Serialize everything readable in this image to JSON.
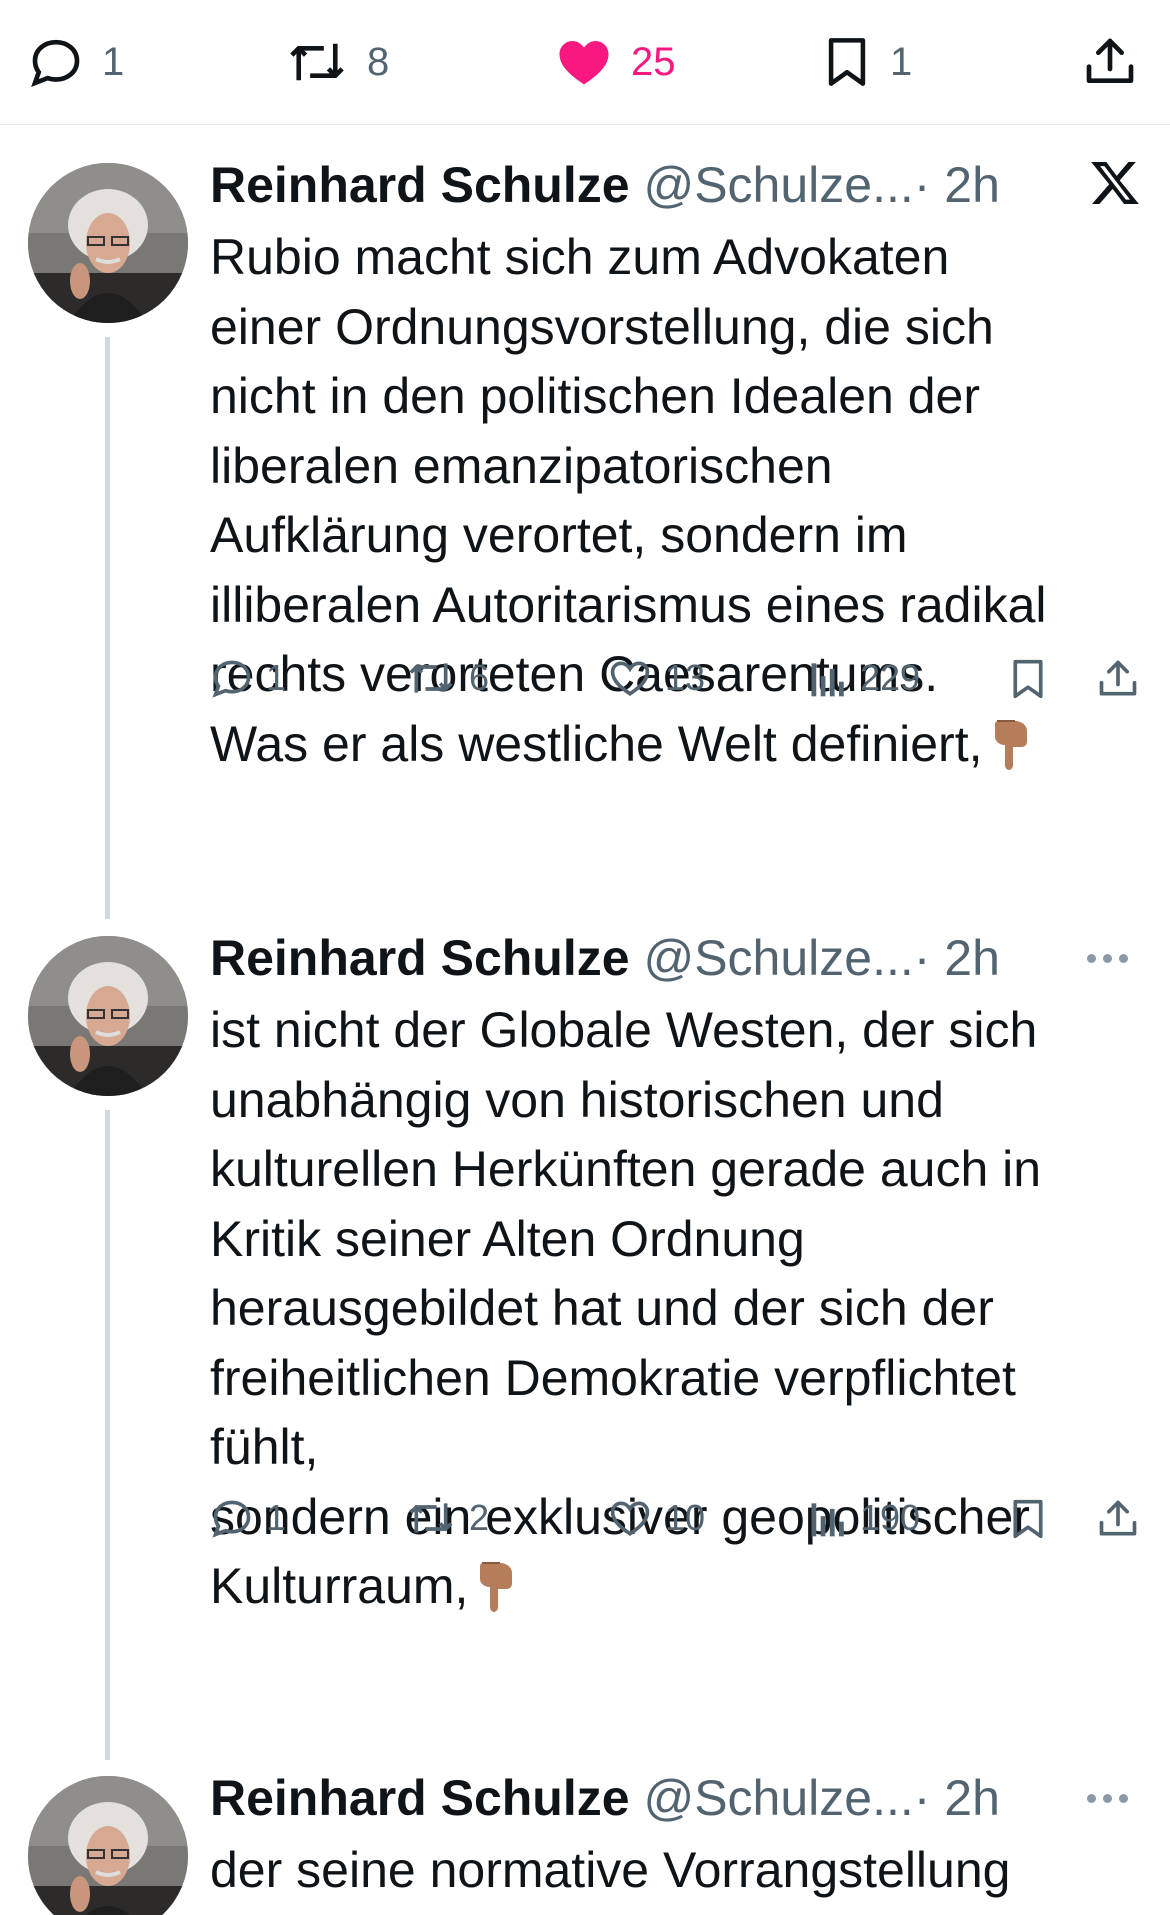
{
  "top_bar": {
    "replies": "1",
    "reposts": "8",
    "likes": "25",
    "bookmarks": "1",
    "like_color": "#f91880"
  },
  "tweets": [
    {
      "name": "Reinhard Schulze",
      "handle": "@Schulze...",
      "time": "· 2h",
      "text": "Rubio macht sich zum Advokaten\neiner Ordnungsvorstellung, die sich\nnicht in den politischen Idealen der\nliberalen emanzipatorischen\nAufklärung verortet, sondern im\nilliberalen Autoritarismus eines radikal\nrechts verorteten Caesarentums.\nWas er als westliche Welt definiert,",
      "emoji": "pointing-down-hand",
      "replies": "1",
      "reposts": "6",
      "likes": "13",
      "views": "229"
    },
    {
      "name": "Reinhard Schulze",
      "handle": "@Schulze...",
      "time": "· 2h",
      "text": "ist nicht der Globale Westen, der sich\nunabhängig von historischen und\nkulturellen Herkünften gerade auch in\nKritik seiner Alten Ordnung\nherausgebildet hat und der sich der\nfreiheitlichen Demokratie verpflichtet\nfühlt,\nsondern ein exklusiver geopolitischer\nKulturraum,",
      "emoji": "pointing-down-hand",
      "replies": "1",
      "reposts": "2",
      "likes": "10",
      "views": "190"
    },
    {
      "name": "Reinhard Schulze",
      "handle": "@Schulze...",
      "time": "· 2h",
      "text": "der seine normative Vorrangstellung"
    }
  ]
}
